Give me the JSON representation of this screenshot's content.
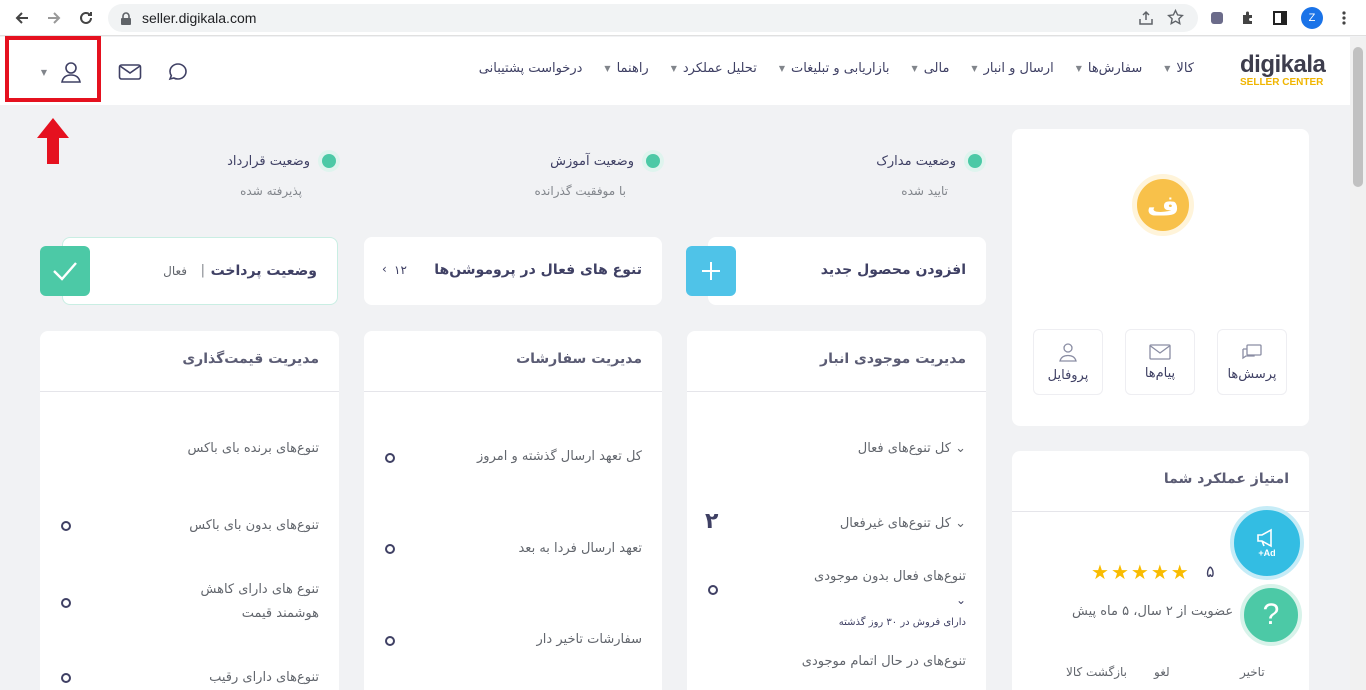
{
  "browser": {
    "url": "seller.digikala.com",
    "profile_initial": "Z"
  },
  "header": {
    "logo_title": "digikala",
    "logo_subtitle": "SELLER CENTER",
    "menu": [
      {
        "label": "کالا"
      },
      {
        "label": "سفارش‌ها"
      },
      {
        "label": "ارسال و انبار"
      },
      {
        "label": "مالی"
      },
      {
        "label": "بازاریابی و تبلیغات"
      },
      {
        "label": "تحلیل عملکرد"
      },
      {
        "label": "راهنما"
      },
      {
        "label": "درخواست پشتیبانی"
      }
    ]
  },
  "statuses": [
    {
      "title": "وضعیت مدارک",
      "value": "تایید شده"
    },
    {
      "title": "وضعیت آموزش",
      "value": "با موفقیت گذرانده"
    },
    {
      "title": "وضعیت قرارداد",
      "value": "پذیرفته شده"
    }
  ],
  "actions": {
    "add_product": "افزودن محصول جدید",
    "promotions": "تنوع های فعال در پروموشن‌ها",
    "promotions_count": "۱۲",
    "payment_title": "وضعیت پرداخت",
    "payment_value": "فعال"
  },
  "inventory": {
    "title": "مدیریت موجودی انبار",
    "active": "کل تنوع‌های فعال",
    "inactive": "کل تنوع‌های غیرفعال",
    "inactive_count": "۲",
    "no_stock": "تنوع‌های فعال بدون موجودی",
    "no_stock_note": "دارای فروش در ۳۰ روز گذشته",
    "finishing": "تنوع‌های در حال اتمام موجودی"
  },
  "orders": {
    "title": "مدیریت سفارشات",
    "rows": [
      "کل تعهد ارسال گذشته و امروز",
      "تعهد ارسال فردا به بعد",
      "سفارشات تاخیر دار"
    ]
  },
  "pricing": {
    "title": "مدیریت قیمت‌گذاری",
    "rows": [
      "تنوع‌های برنده بای باکس",
      "تنوع‌های بدون بای باکس",
      "تنوع های دارای کاهش",
      "هوشمند قیمت",
      "تنوع‌های دارای رقیب"
    ]
  },
  "profile": {
    "avatar_letter": "ف",
    "tiles": [
      "پرسش‌ها",
      "پیام‌ها",
      "پروفایل"
    ]
  },
  "performance": {
    "title": "امتیاز عملکرد شما",
    "score": "۵",
    "stars": 5,
    "membership": "عضویت از ۲ سال، ۵ ماه پیش",
    "columns": [
      "تاخیر",
      "لغو",
      "بازگشت کالا"
    ]
  },
  "fab": {
    "ad_label": "+Ad",
    "help_label": "?"
  },
  "colors": {
    "accent_teal": "#4cc9a6",
    "accent_blue": "#4fc3e8",
    "brand_yellow": "#f0b500",
    "highlight_red": "#e5111f"
  }
}
